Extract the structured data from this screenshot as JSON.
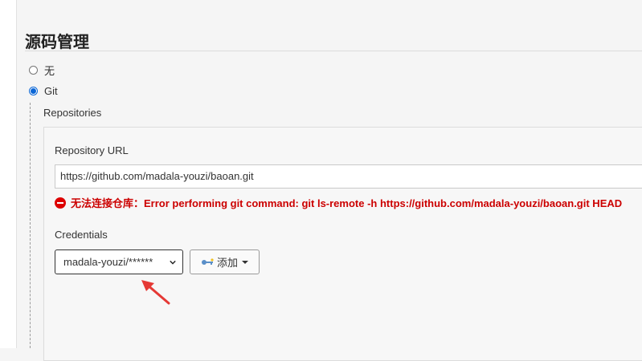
{
  "section": {
    "title": "源码管理"
  },
  "scm_options": [
    {
      "label": "无",
      "selected": false
    },
    {
      "label": "Git",
      "selected": true
    }
  ],
  "git": {
    "repositories_label": "Repositories",
    "repository_url_label": "Repository URL",
    "repository_url_value": "https://github.com/madala-youzi/baoan.git",
    "error_message": "无法连接仓库：Error performing git command: git ls-remote -h https://github.com/madala-youzi/baoan.git HEAD",
    "credentials_label": "Credentials",
    "credentials_selected": "madala-youzi/******",
    "add_button_label": "添加"
  },
  "icons": {
    "error": "error-circle-icon",
    "key": "key-icon",
    "dropdown": "chevron-down-icon",
    "annotation": "red-arrow-annotation"
  },
  "colors": {
    "accent": "#0a66d6",
    "error": "#cc0000",
    "annotation": "#e53935"
  }
}
